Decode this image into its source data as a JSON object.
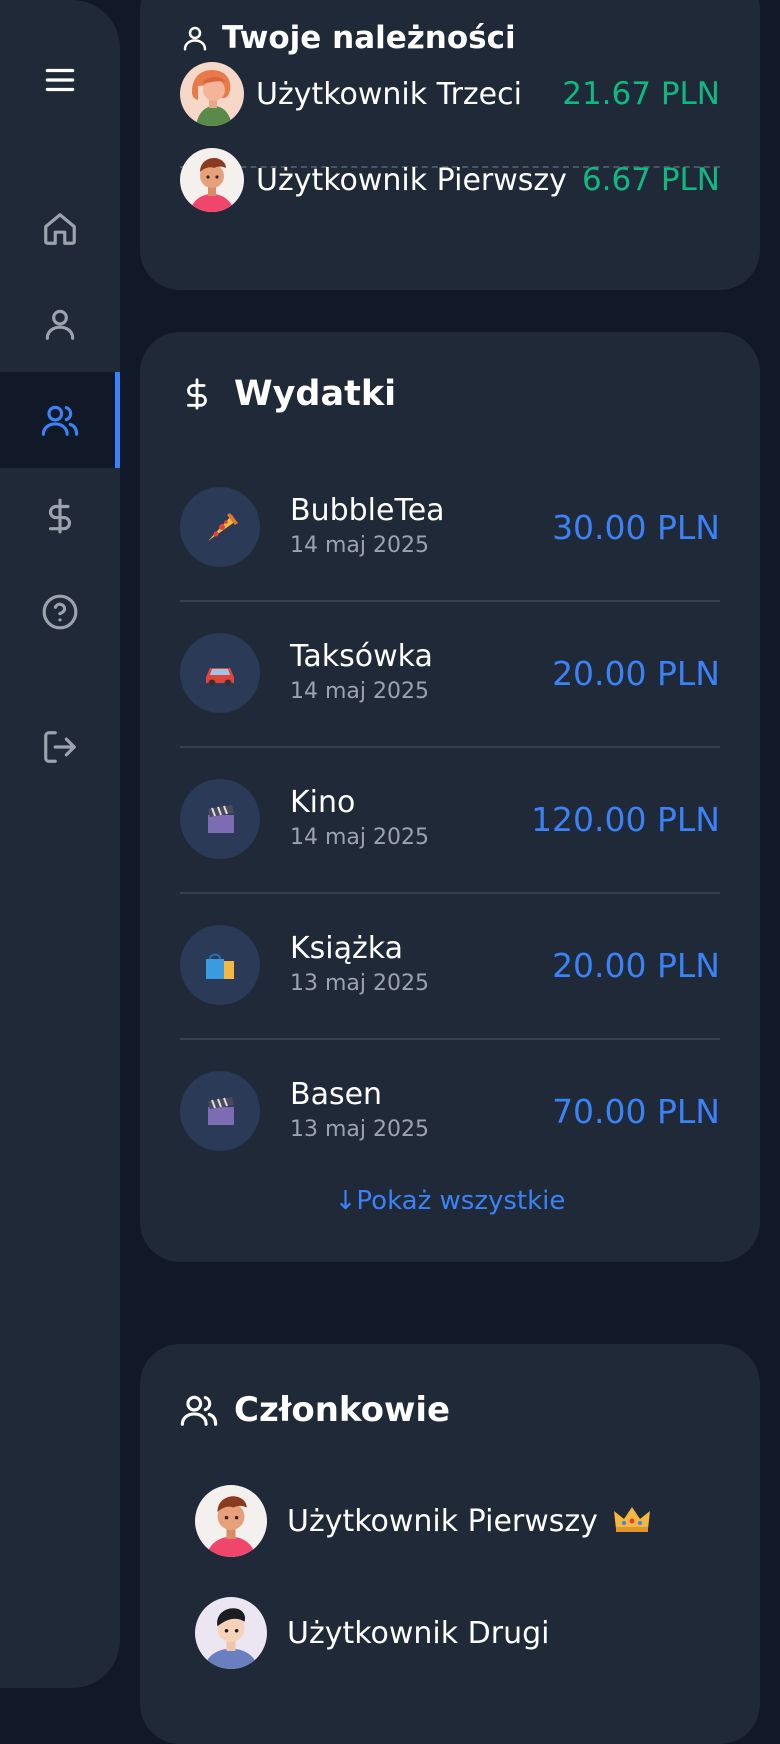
{
  "sidebar": {
    "items": [
      {
        "icon": "menu-icon"
      },
      {
        "icon": "home-icon"
      },
      {
        "icon": "user-icon"
      },
      {
        "icon": "users-icon",
        "active": true
      },
      {
        "icon": "dollar-icon"
      },
      {
        "icon": "help-circle-icon"
      },
      {
        "icon": "logout-icon"
      }
    ]
  },
  "dues": {
    "title": "Twoje należności",
    "items": [
      {
        "name": "Użytkownik Trzeci",
        "amount": "21.67 PLN"
      },
      {
        "name": "Użytkownik Pierwszy",
        "amount": "6.67 PLN"
      }
    ]
  },
  "expenses": {
    "title": "Wydatki",
    "items": [
      {
        "name": "BubbleTea",
        "date": "14 maj 2025",
        "amount": "30.00 PLN",
        "icon": "pizza-icon"
      },
      {
        "name": "Taksówka",
        "date": "14 maj 2025",
        "amount": "20.00 PLN",
        "icon": "car-icon"
      },
      {
        "name": "Kino",
        "date": "14 maj 2025",
        "amount": "120.00 PLN",
        "icon": "clapperboard-icon"
      },
      {
        "name": "Książka",
        "date": "13 maj 2025",
        "amount": "20.00 PLN",
        "icon": "shopping-bags-icon"
      },
      {
        "name": "Basen",
        "date": "13 maj 2025",
        "amount": "70.00 PLN",
        "icon": "clapperboard-icon"
      }
    ],
    "show_all": "Pokaż wszystkie"
  },
  "members": {
    "title": "Członkowie",
    "items": [
      {
        "name": "Użytkownik Pierwszy",
        "badge": "crown-icon"
      },
      {
        "name": "Użytkownik Drugi"
      }
    ]
  },
  "colors": {
    "background": "#111827",
    "card": "#1f2937",
    "accent": "#3b82f6",
    "positive": "#10b981",
    "muted": "#9ca3af"
  }
}
